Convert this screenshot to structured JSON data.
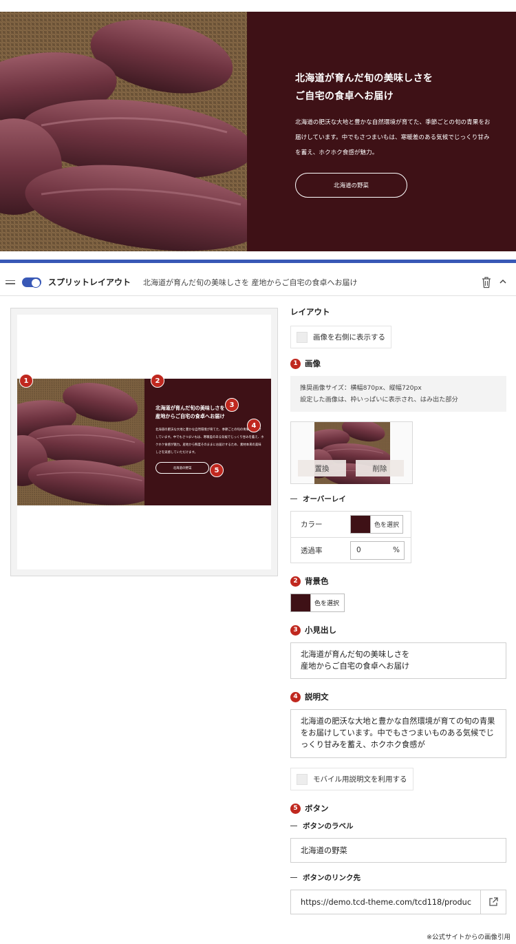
{
  "hero": {
    "title": "北海道が育んだ旬の美味しさを\nご自宅の食卓へお届け",
    "description": "北海道の肥沃な大地と豊かな自然環境が育てた、季節ごとの旬の青果をお届けしています。中でもさつまいもは、寒暖差のある気候でじっくり甘みを蓄え、ホクホク食感が魅力。",
    "button_label": "北海道の野菜",
    "bg_color": "#3e1116"
  },
  "block_header": {
    "name": "スプリットレイアウト",
    "summary": "北海道が育んだ旬の美味しさを 産地からご自宅の食卓へお届け"
  },
  "preview": {
    "title": "北海道が育んだ旬の美味しさを\n産地からご自宅の食卓へお届け",
    "description": "北海道の肥沃な大地と豊かな自然環境が育てた、季節ごとの旬の青果をお届けしています。中でもさつまいもは、寒暖差のある気候でじっくり甘みを蓄え、ホクホク食感が魅力。産地から鮮度そのままにお届けするため、素材本来の美味しさを実感していただけます。",
    "button_label": "北海道の野菜",
    "markers": [
      "1",
      "2",
      "3",
      "4",
      "5"
    ]
  },
  "settings": {
    "layout": {
      "title": "レイアウト",
      "checkbox_label": "画像を右側に表示する"
    },
    "image": {
      "num": "1",
      "title": "画像",
      "note_line1": "推奨画像サイズ：横幅870px、縦幅720px",
      "note_line2": "設定した画像は、枠いっぱいに表示され、はみ出た部分",
      "replace_label": "置換",
      "delete_label": "削除"
    },
    "overlay": {
      "title": "オーバーレイ",
      "color_label": "カラー",
      "color_button": "色を選択",
      "color": "#3e1116",
      "opacity_label": "透過率",
      "opacity_value": "0",
      "opacity_unit": "%"
    },
    "bg_color": {
      "num": "2",
      "title": "背景色",
      "color_button": "色を選択",
      "color": "#3e1116"
    },
    "heading": {
      "num": "3",
      "title": "小見出し",
      "value": "北海道が育んだ旬の美味しさを\n産地からご自宅の食卓へお届け"
    },
    "description": {
      "num": "4",
      "title": "説明文",
      "value": "北海道の肥沃な大地と豊かな自然環境が育ての旬の青果をお届けしています。中でもさつまいものある気候でじっくり甘みを蓄え、ホクホク食感が",
      "mobile_checkbox": "モバイル用説明文を利用する"
    },
    "button": {
      "num": "5",
      "title": "ボタン",
      "label_title": "ボタンのラベル",
      "label_value": "北海道の野菜",
      "link_title": "ボタンのリンク先",
      "link_value": "https://demo.tcd-theme.com/tcd118/produc"
    }
  },
  "credit": "※公式サイトからの画像引用",
  "colors": {
    "accent": "#3858b6",
    "badge": "#c0281f",
    "wine": "#3e1116"
  }
}
